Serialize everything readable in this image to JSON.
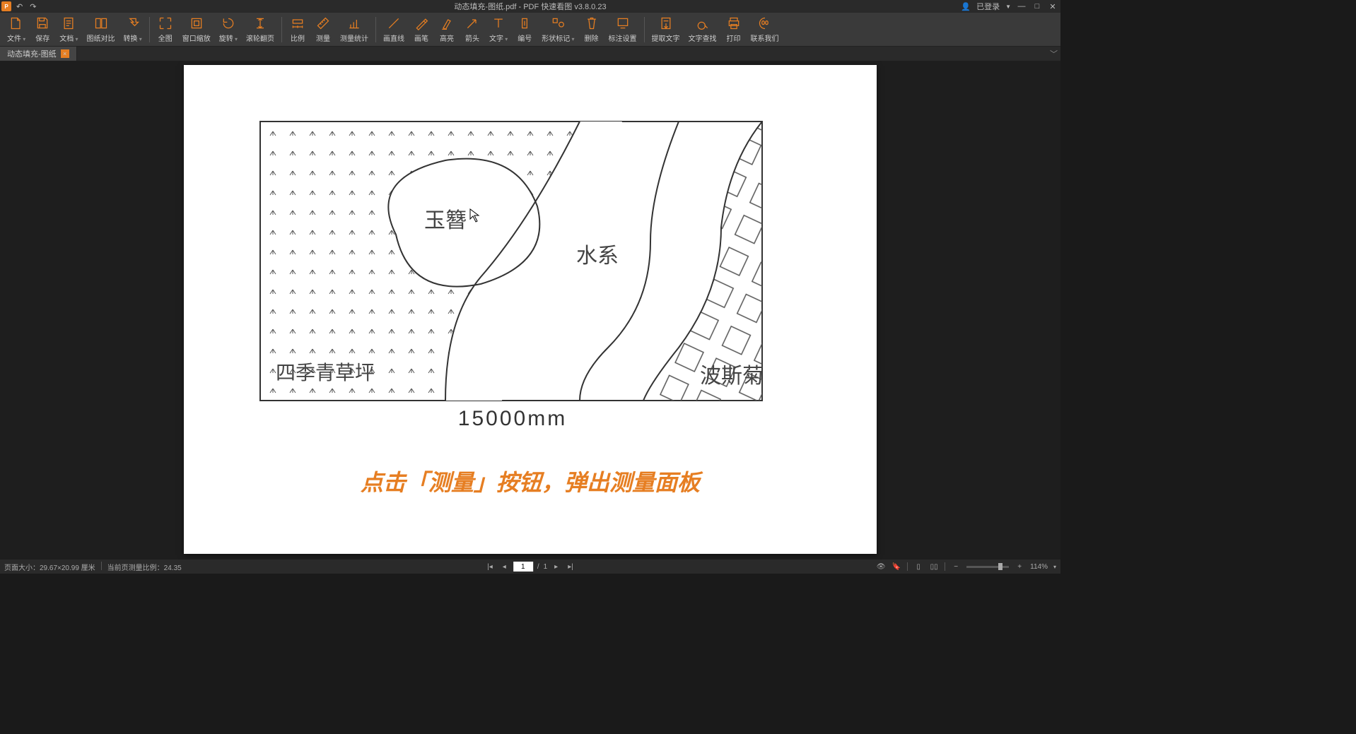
{
  "titlebar": {
    "app_icon_text": "PDF",
    "title": "动态填充-图纸.pdf - PDF 快速看图 v3.8.0.23",
    "login_status": "已登录"
  },
  "toolbar": {
    "items": [
      {
        "label": "文件",
        "dd": true,
        "icon": "file"
      },
      {
        "label": "保存",
        "dd": false,
        "icon": "save"
      },
      {
        "label": "文档",
        "dd": true,
        "icon": "doc"
      },
      {
        "label": "图纸对比",
        "dd": false,
        "icon": "compare"
      },
      {
        "label": "转换",
        "dd": true,
        "icon": "convert"
      },
      {
        "sep": true
      },
      {
        "label": "全图",
        "dd": false,
        "icon": "fit"
      },
      {
        "label": "窗口缩放",
        "dd": false,
        "icon": "zoomwin"
      },
      {
        "label": "旋转",
        "dd": true,
        "icon": "rotate"
      },
      {
        "label": "滚轮翻页",
        "dd": false,
        "icon": "scroll"
      },
      {
        "sep": true
      },
      {
        "label": "比例",
        "dd": false,
        "icon": "scale"
      },
      {
        "label": "测量",
        "dd": false,
        "icon": "measure"
      },
      {
        "label": "测量统计",
        "dd": false,
        "icon": "measurestat"
      },
      {
        "sep": true
      },
      {
        "label": "画直线",
        "dd": false,
        "icon": "line"
      },
      {
        "label": "画笔",
        "dd": false,
        "icon": "pen"
      },
      {
        "label": "高亮",
        "dd": false,
        "icon": "highlight"
      },
      {
        "label": "箭头",
        "dd": false,
        "icon": "arrow"
      },
      {
        "label": "文字",
        "dd": true,
        "icon": "text"
      },
      {
        "label": "编号",
        "dd": false,
        "icon": "number"
      },
      {
        "label": "形状标记",
        "dd": true,
        "icon": "shape"
      },
      {
        "label": "删除",
        "dd": false,
        "icon": "delete"
      },
      {
        "label": "标注设置",
        "dd": false,
        "icon": "annotset"
      },
      {
        "sep": true
      },
      {
        "label": "提取文字",
        "dd": false,
        "icon": "extract"
      },
      {
        "label": "文字查找",
        "dd": false,
        "icon": "search"
      },
      {
        "label": "打印",
        "dd": false,
        "icon": "print"
      },
      {
        "label": "联系我们",
        "dd": false,
        "icon": "contact"
      }
    ]
  },
  "tab": {
    "name": "动态填充-图纸",
    "close": "×"
  },
  "drawing": {
    "label_yuzhan": "玉簪",
    "label_water": "水系",
    "label_lawn": "四季青草坪",
    "label_bosiju": "波斯菊",
    "dimension": "15000mm"
  },
  "instruction": "点击「测量」按钮，弹出测量面板",
  "statusbar": {
    "page_size_label": "页面大小：",
    "page_size_value": "29.67×20.99 厘米",
    "scale_label": "当前页测量比例：",
    "scale_value": "24.35",
    "page_current": "1",
    "page_sep": "/",
    "page_total": "1",
    "zoom": "114%"
  }
}
